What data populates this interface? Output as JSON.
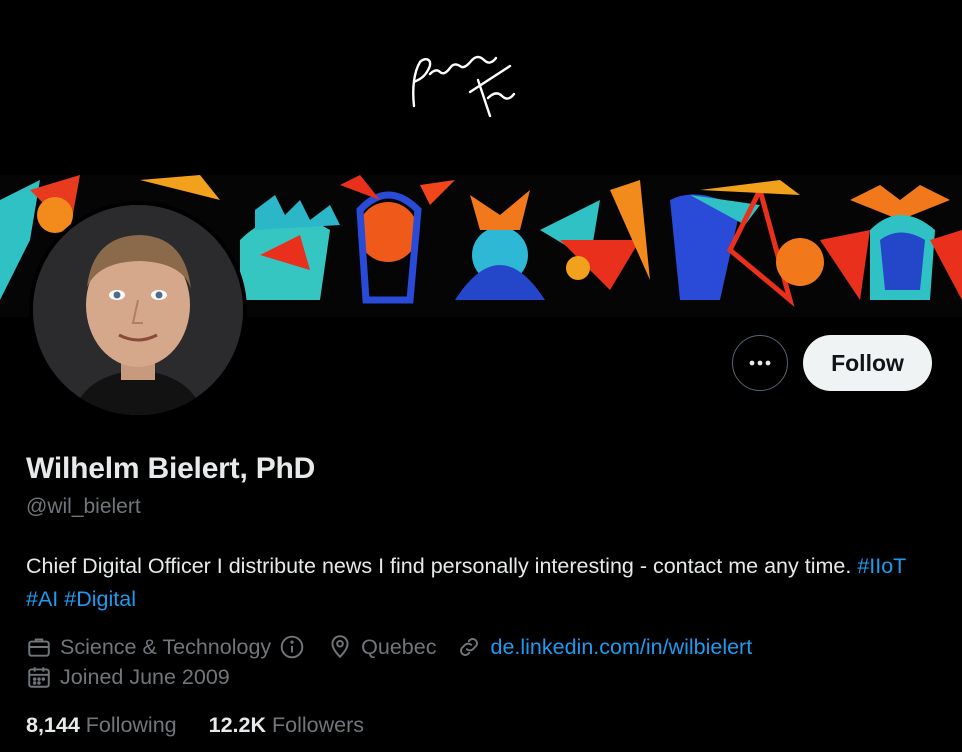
{
  "banner": {
    "logo_text": "Premier Tech"
  },
  "profile": {
    "display_name": "Wilhelm Bielert, PhD",
    "handle": "@wil_bielert",
    "bio_text": "Chief Digital Officer I distribute news I find personally interesting - contact me any time. ",
    "hashtags": [
      "#IIoT",
      "#AI",
      "#Digital"
    ],
    "category": "Science & Technology",
    "location": "Quebec",
    "website": "de.linkedin.com/in/wilbielert",
    "joined": "Joined June 2009",
    "following_count": "8,144",
    "following_label": "Following",
    "followers_count": "12.2K",
    "followers_label": "Followers"
  },
  "actions": {
    "follow_label": "Follow"
  },
  "icons": {
    "more": "more-horizontal-icon",
    "category": "briefcase-icon",
    "info": "info-circle-icon",
    "location": "location-pin-icon",
    "link": "link-icon",
    "calendar": "calendar-icon"
  },
  "colors": {
    "background": "#000000",
    "accent_link": "#1d9bf0",
    "muted": "#71767b",
    "follow_bg": "#eff3f4"
  }
}
